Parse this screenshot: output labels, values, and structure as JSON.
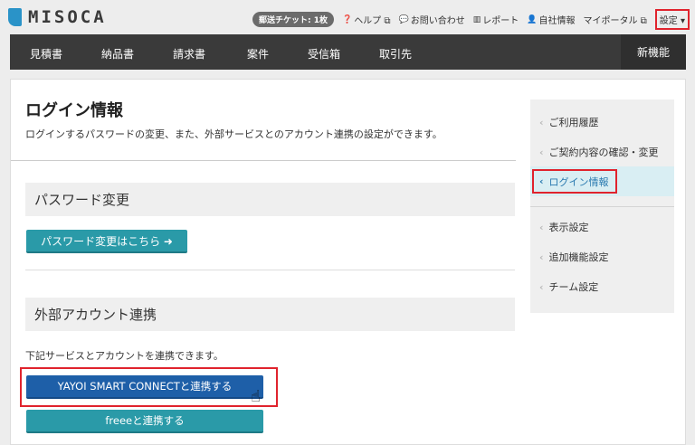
{
  "header": {
    "logo_text": "MISOCA",
    "ticket": "郵送チケット: 1枚",
    "links": [
      {
        "icon": "help-icon",
        "glyph": "❓",
        "label": "ヘルプ ⧉"
      },
      {
        "icon": "chat-icon",
        "glyph": "💬",
        "label": "お問い合わせ"
      },
      {
        "icon": "chart-icon",
        "glyph": "▥",
        "label": "レポート"
      },
      {
        "icon": "user-icon",
        "glyph": "👤",
        "label": "自社情報"
      },
      {
        "icon": "external-icon",
        "glyph": "",
        "label": "マイポータル ⧉"
      }
    ],
    "settings_label": "設定 ▾"
  },
  "nav": {
    "items": [
      "見積書",
      "納品書",
      "請求書",
      "案件",
      "受信箱",
      "取引先"
    ],
    "new_label": "新機能"
  },
  "main": {
    "title": "ログイン情報",
    "description": "ログインするパスワードの変更、また、外部サービスとのアカウント連携の設定ができます。",
    "password_section": {
      "heading": "パスワード変更",
      "button": "パスワード変更はこちら ➜"
    },
    "external_section": {
      "heading": "外部アカウント連携",
      "subtext": "下記サービスとアカウントを連携できます。",
      "yayoi_button": "YAYOI SMART CONNECTと連携する",
      "freee_button": "freeeと連携する"
    }
  },
  "sidebar": {
    "items": [
      {
        "label": "ご利用履歴",
        "active": false
      },
      {
        "label": "ご契約内容の確認・変更",
        "active": false
      },
      {
        "label": "ログイン情報",
        "active": true
      },
      {
        "label": "表示設定",
        "active": false
      },
      {
        "label": "追加機能設定",
        "active": false
      },
      {
        "label": "チーム設定",
        "active": false
      }
    ]
  },
  "colors": {
    "brand_blue": "#2a93c8",
    "nav_dark": "#3a3a3a",
    "teal_button": "#2a9aa8",
    "yayoi_button": "#1e5fa8",
    "highlight_red": "#e0232d"
  }
}
